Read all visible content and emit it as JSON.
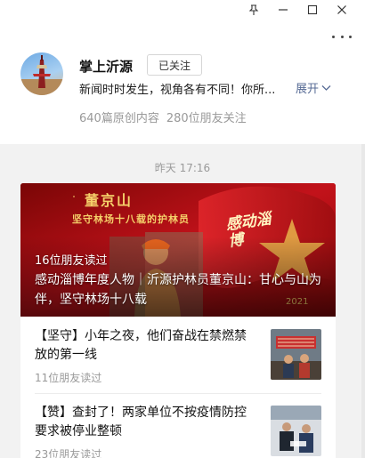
{
  "window": {
    "pin_icon": "pin-icon",
    "minimize_icon": "minimize-icon",
    "maximize_icon": "maximize-icon",
    "close_icon": "close-icon",
    "more_icon": "more-icon"
  },
  "account": {
    "name": "掌上沂源",
    "follow_label": "已关注",
    "description": "新闻时时发生，视角各有不同！你所...",
    "expand_label": "展开",
    "stats": [
      "640篇原创内容",
      "280位朋友关注"
    ]
  },
  "feed": {
    "timestamp": "昨天  17:16",
    "cover": {
      "banner_text": "董京山",
      "banner_subtitle": "坚守林场十八载的护林员",
      "stamp_text": "感动淄博",
      "stamp_year": "2021",
      "reads": "16位朋友读过",
      "title": "感动淄博年度人物｜沂源护林员董京山：甘心与山为伴，坚守林场十八载"
    },
    "articles": [
      {
        "title": "【坚守】小年之夜，他们奋战在禁燃禁放的第一线",
        "reads": "11位朋友读过"
      },
      {
        "title": "【赞】查封了！两家单位不按疫情防控要求被停业整顿",
        "reads": "23位朋友读过"
      }
    ]
  },
  "colors": {
    "link": "#576b95",
    "cover_red": "#a20d0d",
    "banner_gold": "#f5d06a"
  }
}
